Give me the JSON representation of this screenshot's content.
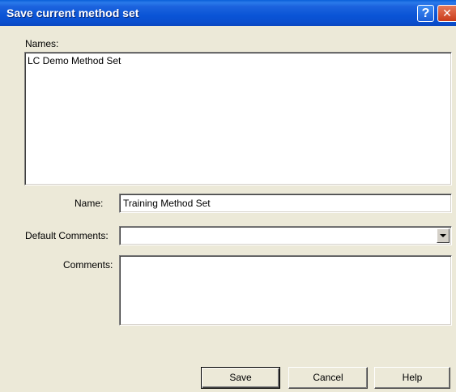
{
  "window": {
    "title": "Save current method set",
    "help_glyph": "?",
    "close_glyph": "✕"
  },
  "names": {
    "label": "Names:",
    "items": [
      "LC Demo Method Set"
    ]
  },
  "name_field": {
    "label": "Name:",
    "value": "Training Method Set"
  },
  "default_comments": {
    "label": "Default Comments:",
    "value": ""
  },
  "comments": {
    "label": "Comments:",
    "value": ""
  },
  "buttons": {
    "save": "Save",
    "cancel": "Cancel",
    "help": "Help"
  },
  "colors": {
    "titlebar": "#0a54d6",
    "dialog_background": "#ece9d8"
  },
  "icons": {
    "help": "question-mark-icon",
    "close": "close-x-icon",
    "dropdown": "chevron-down-icon"
  }
}
